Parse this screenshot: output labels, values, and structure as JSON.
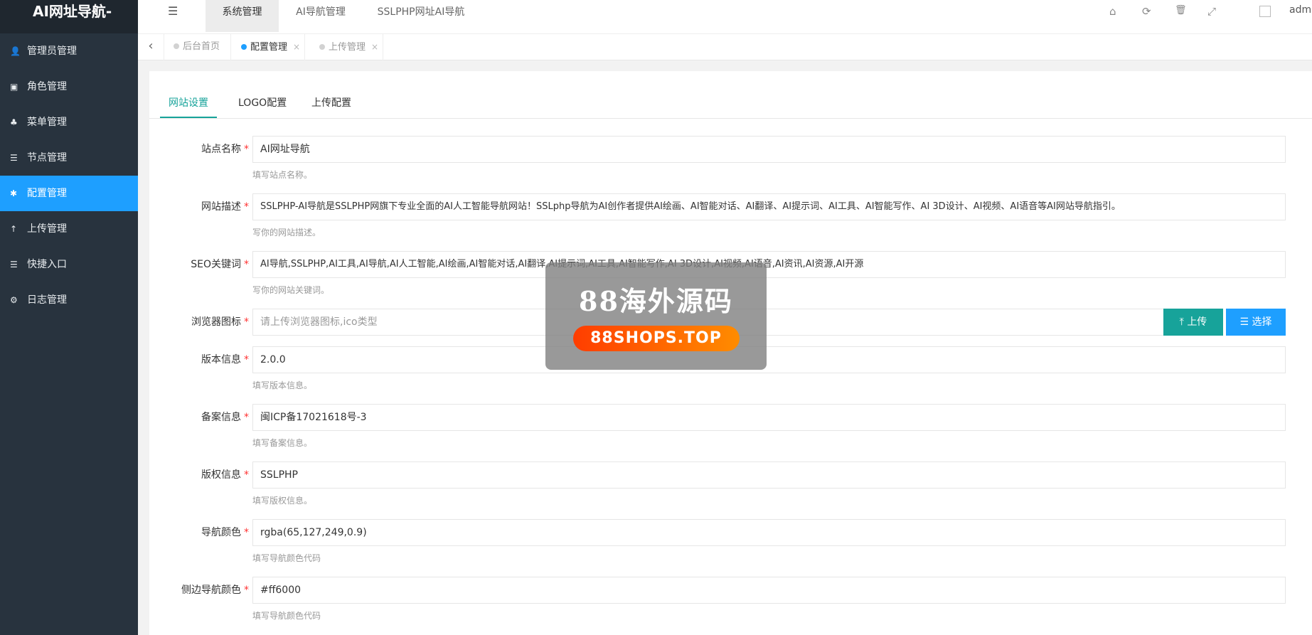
{
  "app": {
    "logo_text": "AI网址导航-"
  },
  "sidebar": {
    "items": [
      {
        "icon": "user-icon",
        "glyph": "👤",
        "label": "管理员管理"
      },
      {
        "icon": "role-icon",
        "glyph": "▣",
        "label": "角色管理"
      },
      {
        "icon": "tree-icon",
        "glyph": "♣",
        "label": "菜单管理"
      },
      {
        "icon": "list-icon",
        "glyph": "☰",
        "label": "节点管理"
      },
      {
        "icon": "asterisk-icon",
        "glyph": "✱",
        "label": "配置管理"
      },
      {
        "icon": "upload-arrow-icon",
        "glyph": "↑",
        "label": "上传管理"
      },
      {
        "icon": "list-icon",
        "glyph": "☰",
        "label": "快捷入口"
      },
      {
        "icon": "gear-icon",
        "glyph": "⚙",
        "label": "日志管理"
      }
    ],
    "active_index": 4
  },
  "header": {
    "toggle_glyph": "☰",
    "tabs": [
      "系统管理",
      "AI导航管理",
      "SSLPHP网址AI导航"
    ],
    "active_tab": 0,
    "icons": {
      "home": "⌂",
      "refresh": "⟳",
      "trash": "🗑",
      "fullscreen": "⤢"
    },
    "user_name": "admin"
  },
  "tabsbar": {
    "back_glyph": "‹",
    "tabs": [
      {
        "label": "后台首页",
        "closable": false
      },
      {
        "label": "配置管理",
        "closable": true,
        "close": "×"
      },
      {
        "label": "上传管理",
        "closable": true,
        "close": "×"
      }
    ],
    "active_index": 1
  },
  "content_tabs": [
    "网站设置",
    "LOGO配置",
    "上传配置"
  ],
  "form": {
    "required_mark": "*",
    "fields": [
      {
        "label": "站点名称",
        "value": "AI网址导航",
        "hint": "填写站点名称。"
      },
      {
        "label": "网站描述",
        "value": "SSLPHP-AI导航是SSLPHP网旗下专业全面的AI人工智能导航网站！SSLphp导航为AI创作者提供AI绘画、AI智能对话、AI翻译、AI提示词、AI工具、AI智能写作、AI 3D设计、AI视频、AI语音等AI网站导航指引。",
        "hint": "写你的网站描述。"
      },
      {
        "label": "SEO关键词",
        "value": "AI导航,SSLPHP,AI工具,AI导航,AI人工智能,AI绘画,AI智能对话,AI翻译,AI提示词,AI工具,AI智能写作,AI 3D设计,AI视频,AI语音,AI资讯,AI资源,AI开源",
        "hint": "写你的网站关键词。"
      },
      {
        "label": "浏览器图标",
        "placeholder": "请上传浏览器图标,ico类型",
        "upload_label": "上传",
        "select_label": "选择"
      },
      {
        "label": "版本信息",
        "value": "2.0.0",
        "hint": "填写版本信息。"
      },
      {
        "label": "备案信息",
        "value": "闽ICP备17021618号-3",
        "hint": "填写备案信息。"
      },
      {
        "label": "版权信息",
        "value": "SSLPHP",
        "hint": "填写版权信息。"
      },
      {
        "label": "导航颜色",
        "value": "rgba(65,127,249,0.9)",
        "hint": "填写导航颜色代码"
      },
      {
        "label": "侧边导航颜色",
        "value": "#ff6000",
        "hint": "填写导航颜色代码"
      }
    ]
  },
  "watermark": {
    "title": "88海外源码",
    "subtitle": "88SHOPS.TOP"
  },
  "colors": {
    "sidebar_bg": "#28333e",
    "active_blue": "#1e9fff",
    "teal": "#17a39a",
    "required_red": "#ff3333"
  }
}
